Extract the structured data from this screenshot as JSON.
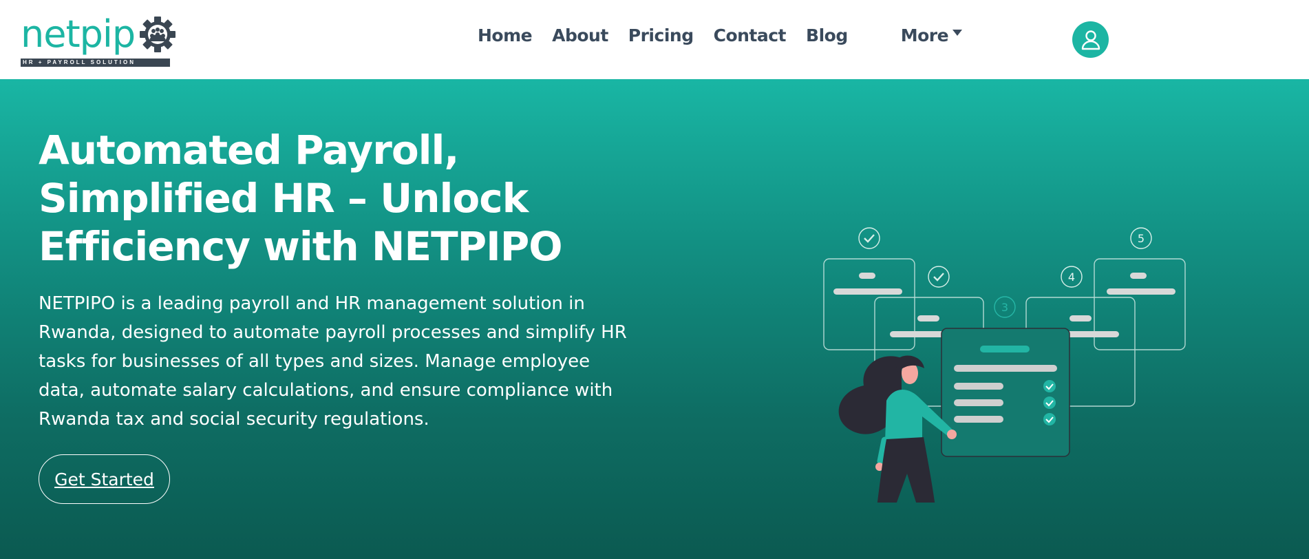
{
  "brand": {
    "name": "netpip",
    "tagline": "HR + PAYROLL SOLUTION",
    "accent": "#1cb5a3",
    "dark": "#3a4652"
  },
  "nav": {
    "items": [
      {
        "label": "Home"
      },
      {
        "label": "About"
      },
      {
        "label": "Pricing"
      },
      {
        "label": "Contact"
      },
      {
        "label": "Blog"
      }
    ],
    "more_label": "More",
    "user_icon": "user-icon"
  },
  "hero": {
    "title": "Automated Payroll, Simplified HR – Unlock Efficiency with NETPIPO",
    "description": "NETPIPO is a leading payroll and HR management solution in Rwanda, designed to automate payroll processes and simplify HR tasks for businesses of all types and sizes. Manage employee data, automate salary calculations, and ensure compliance with Rwanda tax and social security regulations.",
    "cta_label": "Get Started",
    "gradient_top": "#19b6a4",
    "gradient_bottom": "#0b5a51"
  },
  "illustration": {
    "step_numbers": [
      "3",
      "4",
      "5"
    ]
  }
}
